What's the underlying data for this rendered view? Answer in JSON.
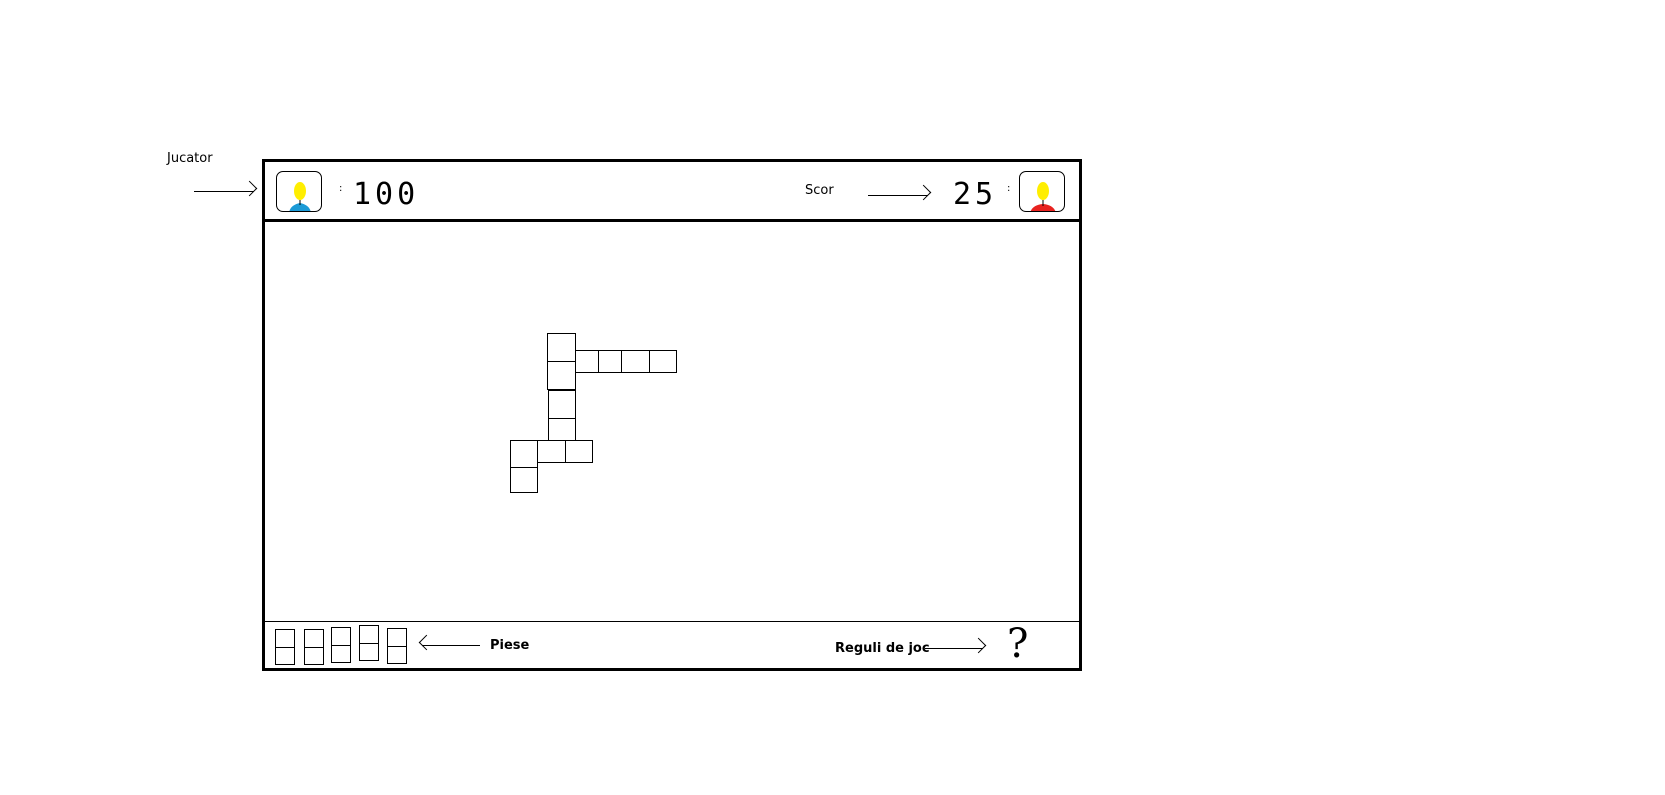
{
  "annotations": {
    "player_label": "Jucator",
    "score_label": "Scor",
    "pieces_label": "Piese",
    "rules_label": "Reguli de joc"
  },
  "top_bar": {
    "player1": {
      "score": "100",
      "avatar_icon": "player-avatar-blue-icon",
      "hair_color": "#ffee00",
      "shirt_color": "#1b9ad6"
    },
    "player2": {
      "score": "25",
      "avatar_icon": "player-avatar-red-icon",
      "hair_color": "#ffee00",
      "shirt_color": "#e8221f"
    }
  },
  "bottom_bar": {
    "help_symbol": "?",
    "pieces_count": 5
  }
}
